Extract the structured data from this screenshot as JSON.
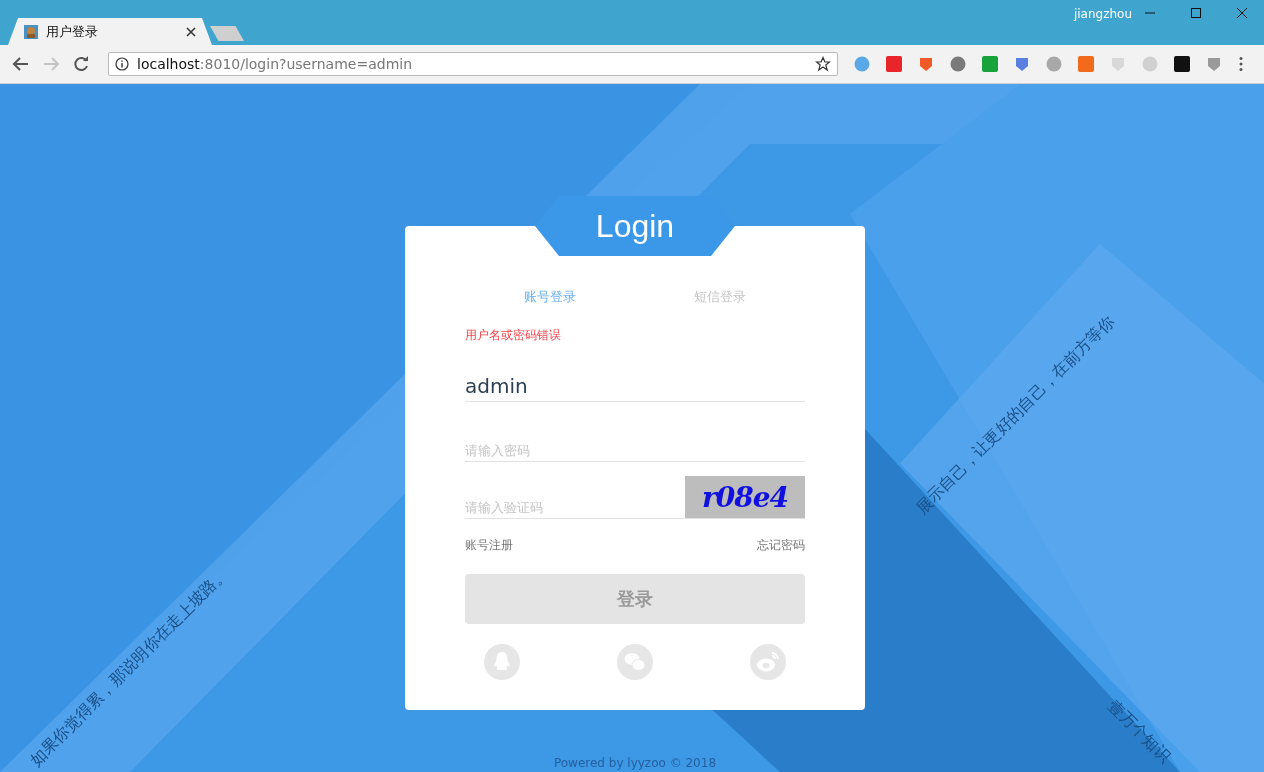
{
  "window": {
    "user": "jiangzhou"
  },
  "tabs": [
    {
      "title": "用户登录",
      "selected": true
    }
  ],
  "address": {
    "host": "localhost",
    "path": ":8010/login?username=admin"
  },
  "login": {
    "title": "Login",
    "modes": [
      {
        "label": "账号登录",
        "selected": true
      },
      {
        "label": "短信登录",
        "selected": false
      }
    ],
    "error": "用户名或密码错误",
    "fields": [
      {
        "kind": "text",
        "value": "admin"
      },
      {
        "kind": "password",
        "placeholder": "请输入密码"
      },
      {
        "kind": "captcha",
        "placeholder": "请输入验证码",
        "code": "r08e4"
      }
    ],
    "links": [
      "账号注册",
      "忘记密码"
    ],
    "button": {
      "label": "登录",
      "disabled": true
    }
  },
  "slogans": [
    "如果你觉得累，那说明你在走上坡路。",
    "展示自己，让更好的自己，在前方等你",
    "壹万个知识"
  ],
  "footer": "Powered by lyyzoo © 2018"
}
